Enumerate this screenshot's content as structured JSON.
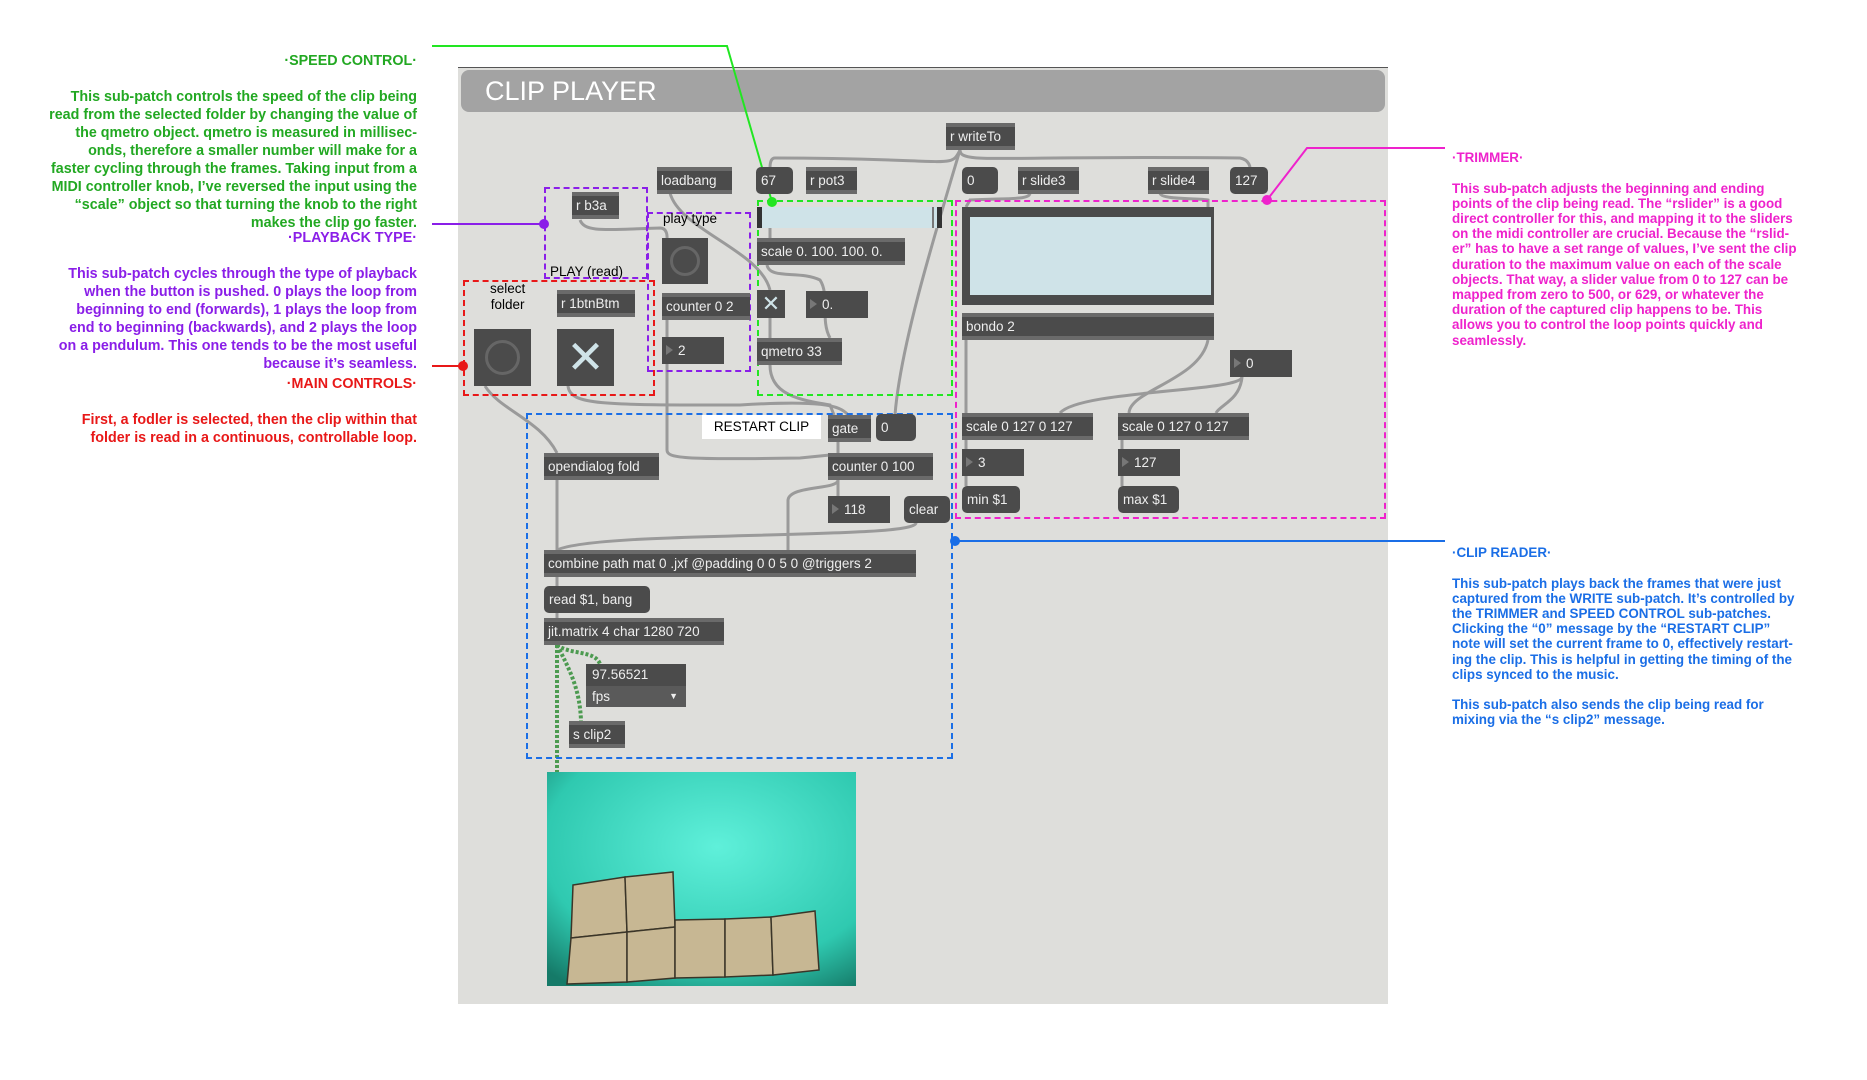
{
  "annotations": {
    "speed_control": {
      "title": "·SPEED CONTROL·",
      "body": "This sub-patch controls the speed of the clip being\nread from the selected folder by changing the value of\nthe qmetro object. qmetro is measured in millisec-\nonds, therefore a smaller number will make for a\nfaster cycling through the frames. Taking input from a\nMIDI controller knob, I’ve reversed the input using the\n“scale” object so that turning the knob to the right\nmakes the clip go faster.",
      "color": "#22a822"
    },
    "playback_type": {
      "title": "·PLAYBACK TYPE·",
      "body": "This sub-patch cycles through the type of playback\nwhen the button is pushed. 0 plays the loop from\nbeginning to end (forwards), 1 plays the loop from\nend to beginning (backwards), and 2 plays the loop\non a pendulum. This one tends to be the most useful\nbecause it’s seamless.",
      "color": "#8a1ee8"
    },
    "main_controls": {
      "title": "·MAIN CONTROLS·",
      "body": "First, a fodler is selected, then the clip within that\nfolder is read in a continuous, controllable loop.",
      "color": "#e81818"
    },
    "trimmer": {
      "title": "·TRIMMER·",
      "body": "This sub-patch adjusts the beginning and ending\npoints of the clip being read. The “rslider” is a good\ndirect controller for this, and mapping it to the sliders\non the midi controller are crucial. Because the “rslid-\ner” has to have a set range of values, I’ve sent the clip\nduration to the maximum value on each of the scale\nobjects. That way, a slider value from 0 to 127 can be\nmapped from zero to 500, or 629, or whatever the\nduration of the captured clip happens to be. This\nallows you to control the loop points quickly and\nseamlessly.",
      "color": "#ee22cc"
    },
    "clip_reader": {
      "title": "·CLIP READER·",
      "body": "This sub-patch plays back the frames that were just\ncaptured from the WRITE sub-patch. It’s controlled by\nthe TRIMMER and SPEED CONTROL sub-patches.\nClicking the “0” message by the “RESTART CLIP”\nnote will set the current frame to 0, effectively restart-\ning the clip. This is helpful in getting the timing of the\nclips synced to the music.\n\nThis sub-patch also sends the clip being read for\nmixing via the “s clip2” message.",
      "color": "#1a6ee6"
    }
  },
  "patcher": {
    "title": "CLIP PLAYER",
    "labels": {
      "play_type": "play type",
      "play_read": "PLAY (read)",
      "select_folder": "select\nfolder",
      "restart_clip": "RESTART CLIP"
    },
    "objects": {
      "loadbang": "loadbang",
      "r_pot3": "r pot3",
      "r_b3a": "r b3a",
      "counter_0_2": "counter 0 2",
      "scale_speed": "scale 0. 100. 100. 0.",
      "qmetro": "qmetro 33",
      "r_1btnBtm": "r 1btnBtm",
      "r_writeTo": "r writeTo",
      "r_slide3": "r slide3",
      "r_slide4": "r slide4",
      "bondo": "bondo 2",
      "scale_left": "scale 0 127 0 127",
      "scale_right": "scale 0 127 0 127",
      "gate": "gate",
      "opendialog": "opendialog fold",
      "counter_0_100": "counter 0 100",
      "combine": "combine path mat 0 .jxf @padding 0 0 5 0 @triggers 2",
      "jit_matrix": "jit.matrix 4 char 1280 720",
      "s_clip2": "s clip2"
    },
    "messages": {
      "msg_67": "67",
      "msg_0_top": "0",
      "msg_127": "127",
      "min": "min $1",
      "max": "max $1",
      "msg_0_restart": "0",
      "clear": "clear",
      "read_bang": "read $1, bang"
    },
    "numbers": {
      "play_type_value": "2",
      "speed_float": "0.",
      "trim_value": "0",
      "scale_left_out": "3",
      "scale_right_out": "127",
      "counter_out": "118"
    },
    "fps": {
      "value": "97.56521",
      "unit": "fps"
    },
    "speed_slider_value": 100,
    "rslider_range": [
      0,
      127
    ],
    "panel_colors": {
      "slider_fill": "#cfe3e8",
      "object_bg": "#4b4b4b",
      "patcher_bg": "#dededb"
    }
  }
}
